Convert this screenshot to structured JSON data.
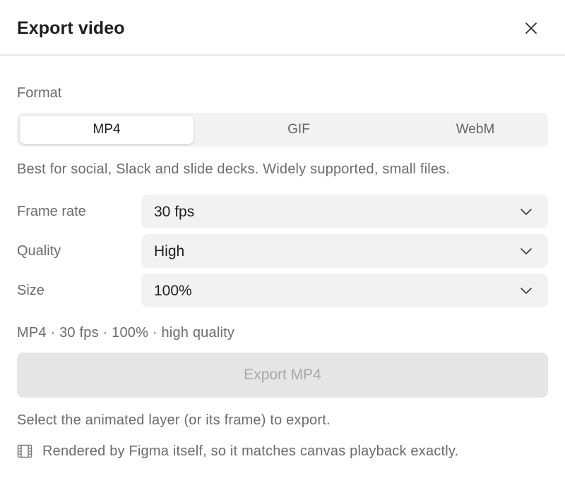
{
  "dialog": {
    "title": "Export video",
    "close_icon": "close-icon"
  },
  "format": {
    "label": "Format",
    "options": [
      "MP4",
      "GIF",
      "WebM"
    ],
    "selected": "MP4",
    "description": "Best for social, Slack and slide decks. Widely supported, small files."
  },
  "settings": {
    "frame_rate": {
      "label": "Frame rate",
      "value": "30 fps"
    },
    "quality": {
      "label": "Quality",
      "value": "High"
    },
    "size": {
      "label": "Size",
      "value": "100%"
    },
    "chevron_icon": "chevron-down-icon"
  },
  "summary": "MP4 · 30 fps · 100% · high quality",
  "export_button": {
    "label": "Export MP4",
    "disabled": true
  },
  "hint": "Select the animated layer (or its frame) to export.",
  "note": {
    "icon": "film-icon",
    "text": "Rendered by Figma itself, so it matches canvas playback exactly."
  },
  "colors": {
    "text_primary": "#1e1e1e",
    "text_secondary": "#6b6b6b",
    "field_bg": "#f2f2f2",
    "button_disabled_bg": "#e5e5e5",
    "button_disabled_text": "#a8a8a8",
    "divider": "#e6e6e6"
  }
}
